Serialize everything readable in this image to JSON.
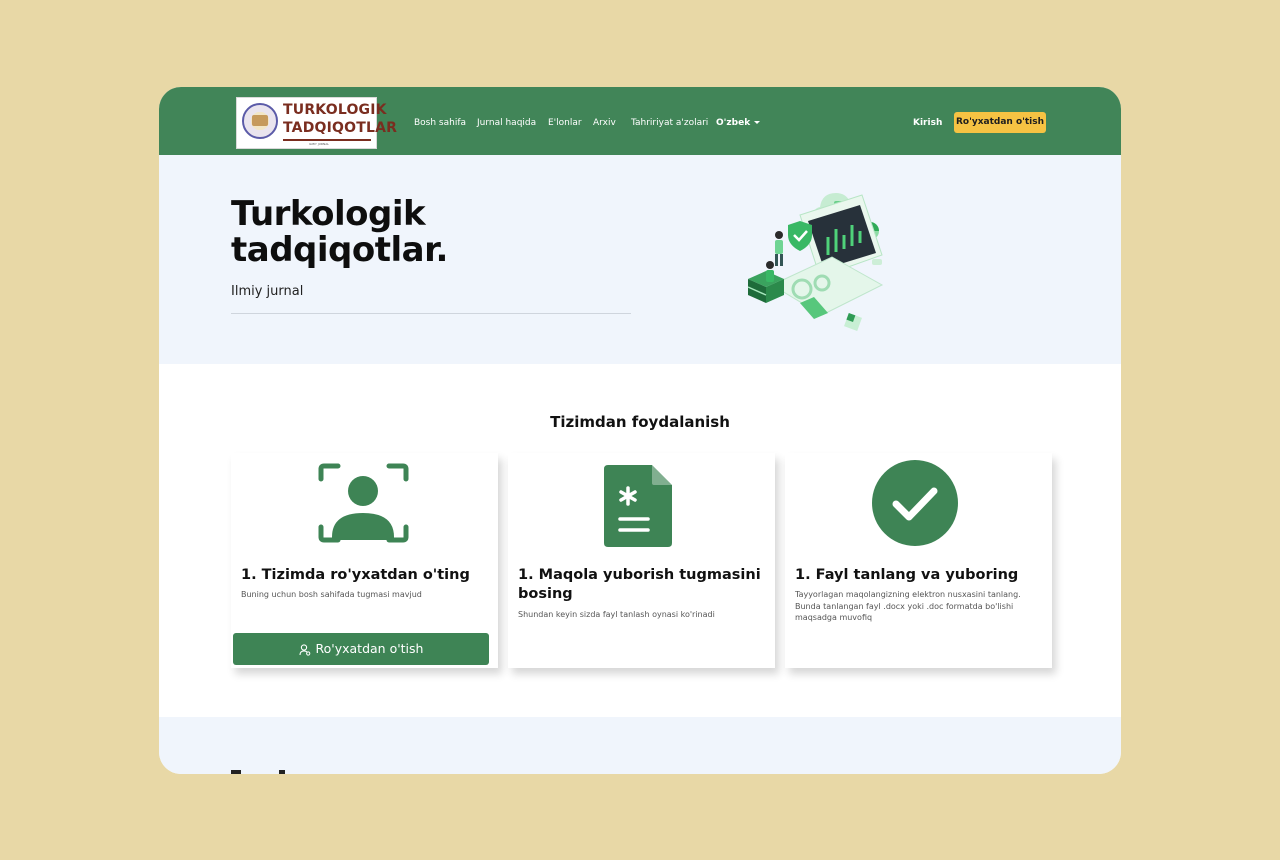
{
  "navbar": {
    "logo": {
      "line1": "TURKOLOGIK",
      "line2": "TADQIQOTLAR",
      "tagline": "ILMIY JURNAL"
    },
    "links": [
      "Bosh sahifa",
      "Jurnal haqida",
      "E'lonlar",
      "Arxiv",
      "Tahririyat a'zolari"
    ],
    "language": "O'zbek",
    "login": "Kirish",
    "register": "Ro'yxatdan o'tish",
    "colors": {
      "bar": "#418558",
      "register_button": "#f6c343"
    }
  },
  "hero": {
    "title": "Turkologik tadqiqotlar.",
    "subtitle": "Ilmiy jurnal",
    "illustration": "security-isometric-illustration"
  },
  "usage": {
    "title": "Tizimdan foydalanish",
    "cards": [
      {
        "icon": "user-scan-icon",
        "title": "1. Tizimda ro'yxatdan o'ting",
        "description": "Buning uchun bosh sahifada tugmasi mavjud",
        "button": "Ro'yxatdan o'tish"
      },
      {
        "icon": "file-asterisk-icon",
        "title": "1. Maqola yuborish tugmasini bosing",
        "description": "Shundan keyin sizda fayl tanlash oynasi ko'rinadi"
      },
      {
        "icon": "check-circle-icon",
        "title": "1. Fayl tanlang va yuboring",
        "description": "Tayyorlagan maqolangizning elektron nusxasini tanlang. Bunda tanlangan fayl .docx yoki .doc formatda bo'lishi maqsadga muvofiq"
      }
    ],
    "accent": "#3e8455"
  },
  "page_background": "#e8d8a6"
}
